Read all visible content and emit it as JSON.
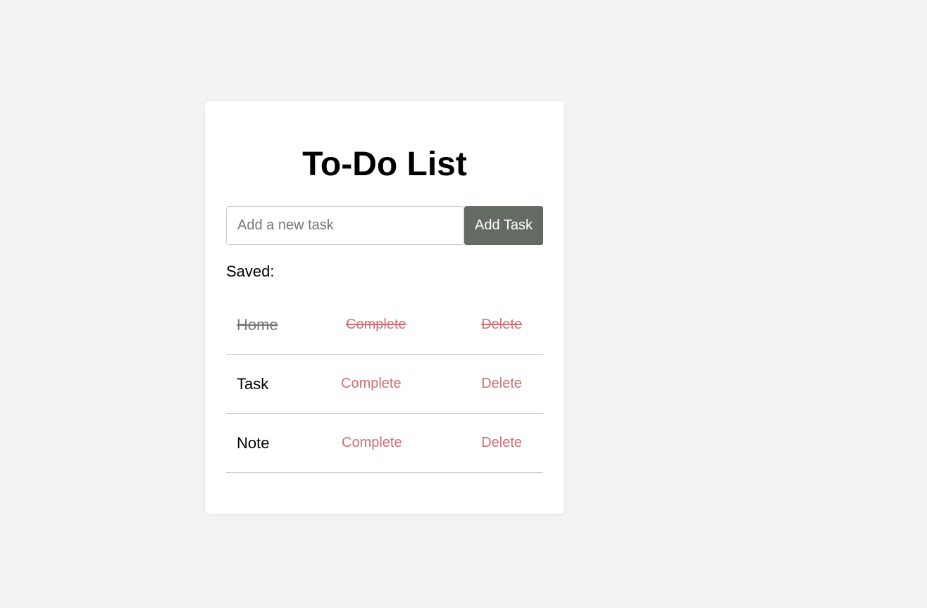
{
  "header": {
    "title": "To-Do List"
  },
  "add_form": {
    "input_value": "",
    "input_placeholder": "Add a new task",
    "button_label": "Add Task"
  },
  "saved_label": "Saved:",
  "tasks": [
    {
      "text": "Home",
      "complete_label": "Complete",
      "delete_label": "Delete",
      "completed": true
    },
    {
      "text": "Task",
      "complete_label": "Complete",
      "delete_label": "Delete",
      "completed": false
    },
    {
      "text": "Note",
      "complete_label": "Complete",
      "delete_label": "Delete",
      "completed": false
    }
  ],
  "colors": {
    "page_background": "#f3f3f3",
    "card_background": "#ffffff",
    "button_background": "#646b63",
    "action_link": "#d06e77",
    "divider": "#cccccc"
  }
}
